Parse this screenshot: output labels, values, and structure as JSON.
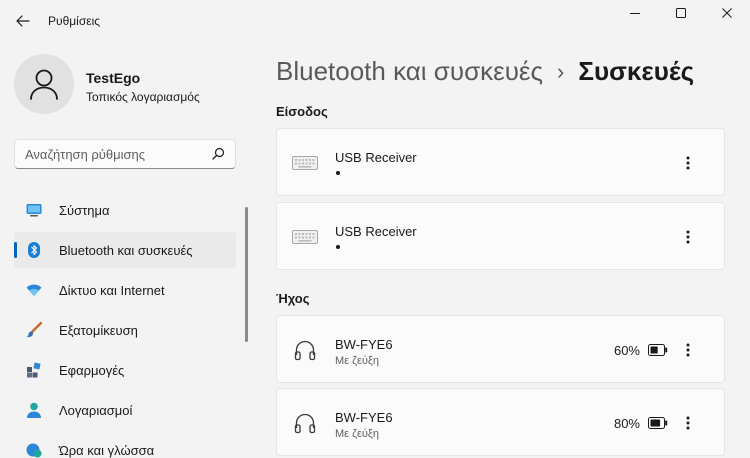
{
  "window": {
    "title": "Ρυθμίσεις"
  },
  "user": {
    "name": "TestEgo",
    "account_type": "Τοπικός λογαριασμός"
  },
  "search": {
    "placeholder": "Αναζήτηση ρύθμισης"
  },
  "sidebar": {
    "items": [
      {
        "label": "Σύστημα",
        "icon": "system-icon",
        "active": false
      },
      {
        "label": "Bluetooth και συσκευές",
        "icon": "bluetooth-icon",
        "active": true
      },
      {
        "label": "Δίκτυο και Internet",
        "icon": "wifi-icon",
        "active": false
      },
      {
        "label": "Εξατομίκευση",
        "icon": "brush-icon",
        "active": false
      },
      {
        "label": "Εφαρμογές",
        "icon": "apps-icon",
        "active": false
      },
      {
        "label": "Λογαριασμοί",
        "icon": "account-icon",
        "active": false
      },
      {
        "label": "Ώρα και γλώσσα",
        "icon": "globe-clock-icon",
        "active": false
      }
    ]
  },
  "breadcrumb": {
    "parent": "Bluetooth και συσκευές",
    "separator": "›",
    "current": "Συσκευές"
  },
  "sections": {
    "input": {
      "title": "Είσοδος",
      "devices": [
        {
          "name": "USB Receiver",
          "icon": "keyboard-icon"
        },
        {
          "name": "USB Receiver",
          "icon": "keyboard-icon"
        }
      ]
    },
    "audio": {
      "title": "Ήχος",
      "devices": [
        {
          "name": "BW-FYE6",
          "status": "Με ζεύξη",
          "battery": "60%",
          "battery_level": 0.6,
          "icon": "headphones-icon"
        },
        {
          "name": "BW-FYE6",
          "status": "Με ζεύξη",
          "battery": "80%",
          "battery_level": 0.8,
          "icon": "headphones-icon"
        }
      ]
    }
  },
  "colors": {
    "accent": "#0067c0",
    "background": "#f3f3f3",
    "card": "#fbfbfb"
  }
}
